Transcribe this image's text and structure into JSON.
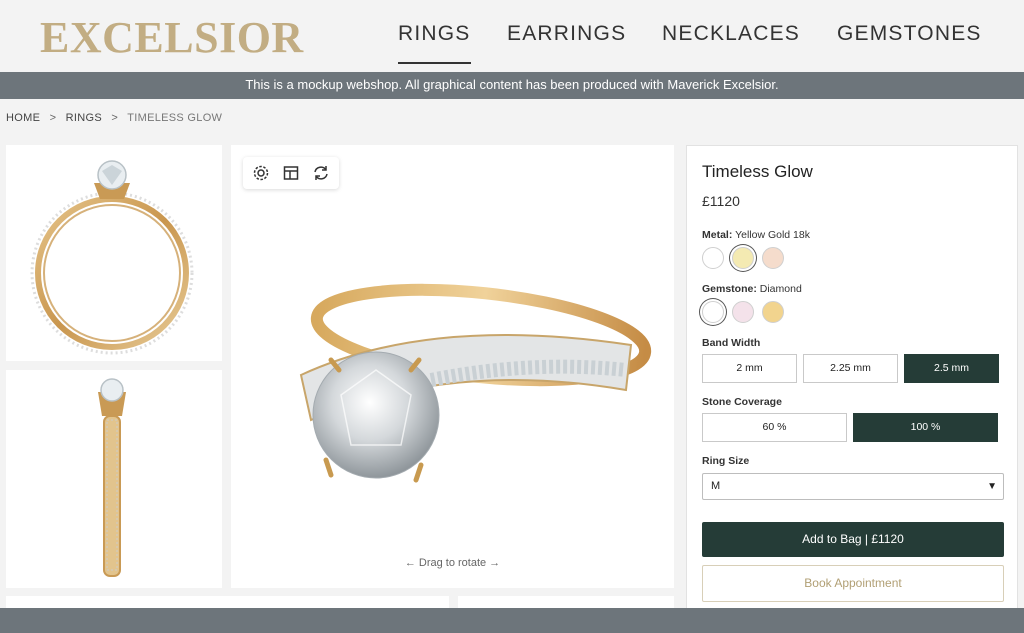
{
  "header": {
    "logo": "EXCELSIOR",
    "nav": [
      {
        "label": "RINGS",
        "active": true
      },
      {
        "label": "EARRINGS",
        "active": false
      },
      {
        "label": "NECKLACES",
        "active": false
      },
      {
        "label": "GEMSTONES",
        "active": false
      }
    ]
  },
  "banner": "This is a mockup webshop. All graphical content has been produced with Maverick Excelsior.",
  "breadcrumb": [
    "HOME",
    "RINGS",
    "TIMELESS GLOW"
  ],
  "breadcrumb_separator": ">",
  "viewer": {
    "toolbar_icons": [
      "settings-icon",
      "layout-icon",
      "rotate-icon"
    ],
    "drag_hint": "← Drag to rotate →"
  },
  "product": {
    "title": "Timeless Glow",
    "price": "£1120",
    "metal": {
      "label": "Metal:",
      "value": "Yellow Gold 18k",
      "swatches": [
        {
          "color": "#ffffff",
          "selected": false
        },
        {
          "color": "#f4eab2",
          "selected": true
        },
        {
          "color": "#f5dccc",
          "selected": false
        }
      ]
    },
    "gemstone": {
      "label": "Gemstone:",
      "value": "Diamond",
      "swatches": [
        {
          "color": "#ffffff",
          "selected": true
        },
        {
          "color": "#f4e2ea",
          "selected": false
        },
        {
          "color": "#f2d48e",
          "selected": false
        }
      ]
    },
    "band_width": {
      "label": "Band Width",
      "options": [
        "2 mm",
        "2.25 mm",
        "2.5 mm"
      ],
      "selected": "2.5 mm"
    },
    "stone_coverage": {
      "label": "Stone Coverage",
      "options": [
        "60 %",
        "100 %"
      ],
      "selected": "100 %"
    },
    "ring_size": {
      "label": "Ring Size",
      "value": "M"
    },
    "add_to_bag": "Add to Bag | £1120",
    "book_appointment": "Book Appointment"
  },
  "colors": {
    "accent_dark": "#253c37",
    "gold": "#c2ad83",
    "banner": "#6d757b"
  }
}
